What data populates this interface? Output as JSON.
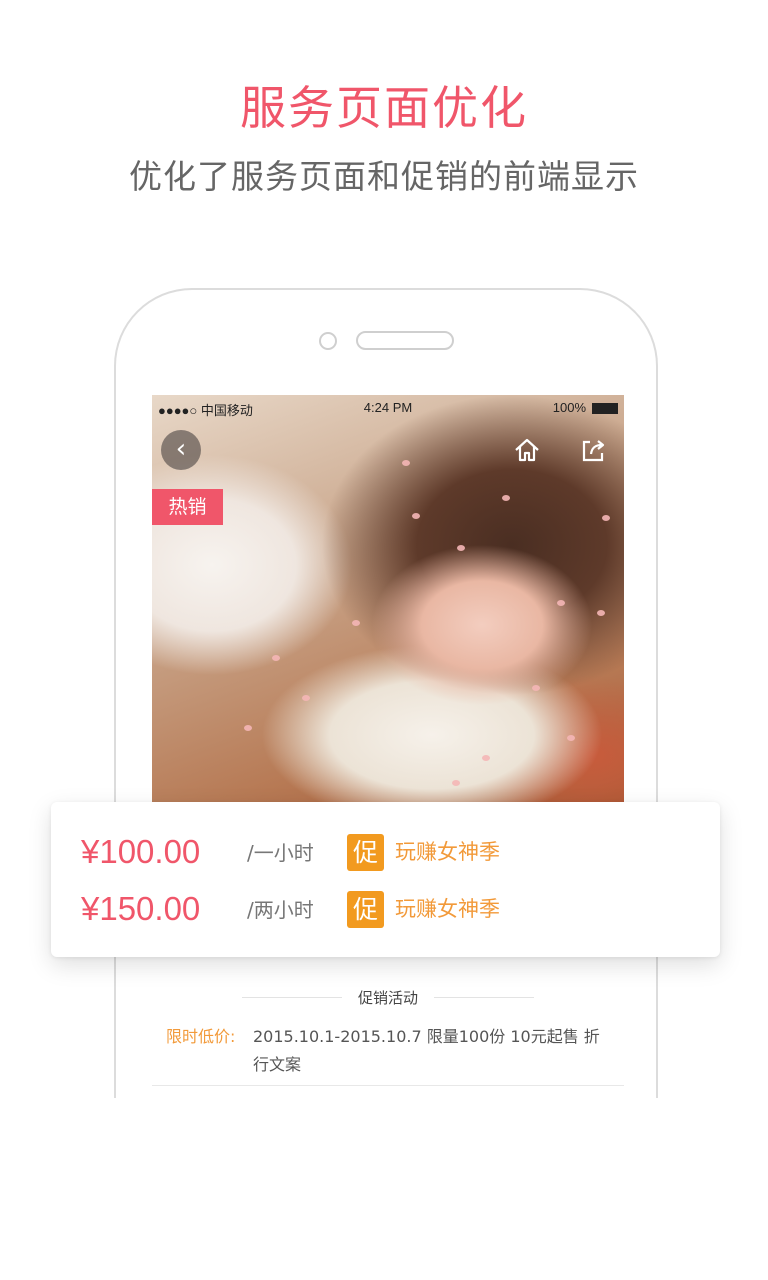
{
  "header": {
    "title": "服务页面优化",
    "subtitle": "优化了服务页面和促销的前端显示"
  },
  "status_bar": {
    "carrier": "●●●●○ 中国移动",
    "time": "4:24 PM",
    "battery": "100%"
  },
  "product": {
    "back_glyph": "‹",
    "hot_badge": "热销"
  },
  "prices": [
    {
      "price": "¥100.00",
      "unit": "/一小时",
      "tag": "促",
      "promo": "玩赚女神季"
    },
    {
      "price": "¥150.00",
      "unit": "/两小时",
      "tag": "促",
      "promo": "玩赚女神季"
    }
  ],
  "promotion": {
    "section_title": "促销活动",
    "label": "限时低价:",
    "text": "2015.10.1-2015.10.7  限量100份  10元起售 折行文案"
  },
  "colors": {
    "accent": "#f0566a",
    "promo_orange": "#f29a1f",
    "subtitle_gray": "#666666"
  },
  "icons": [
    "back-arrow-icon",
    "home-icon",
    "share-icon",
    "battery-icon"
  ]
}
